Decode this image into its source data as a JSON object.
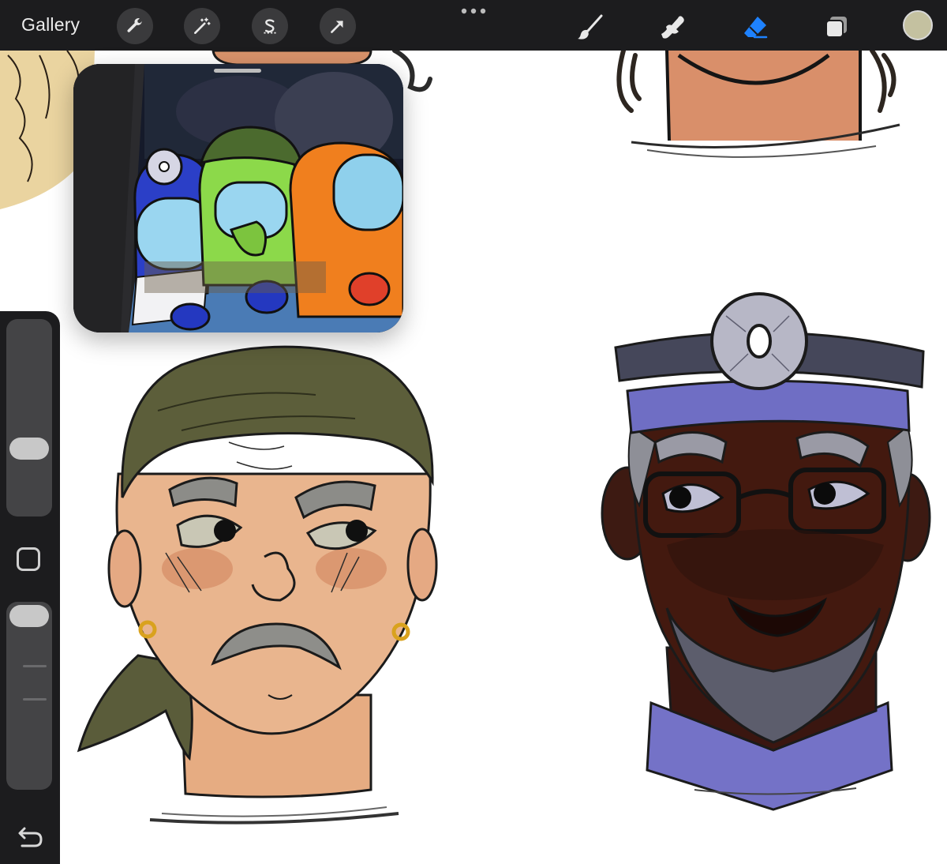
{
  "toolbar": {
    "gallery_label": "Gallery",
    "left_tools": [
      "wrench-icon",
      "magic-wand-icon",
      "selection-s-icon",
      "arrow-transform-icon"
    ],
    "right_tools": [
      "brush-icon",
      "smudge-icon",
      "eraser-icon",
      "layers-icon"
    ],
    "active_tool": "eraser-icon",
    "colors": {
      "bar": "#1c1c1e",
      "active_tool": "#1e82ff",
      "current_color": "#c4c1a0"
    }
  },
  "sidebar": {
    "brush_size_level": 0.32,
    "opacity_level": 1.0
  }
}
